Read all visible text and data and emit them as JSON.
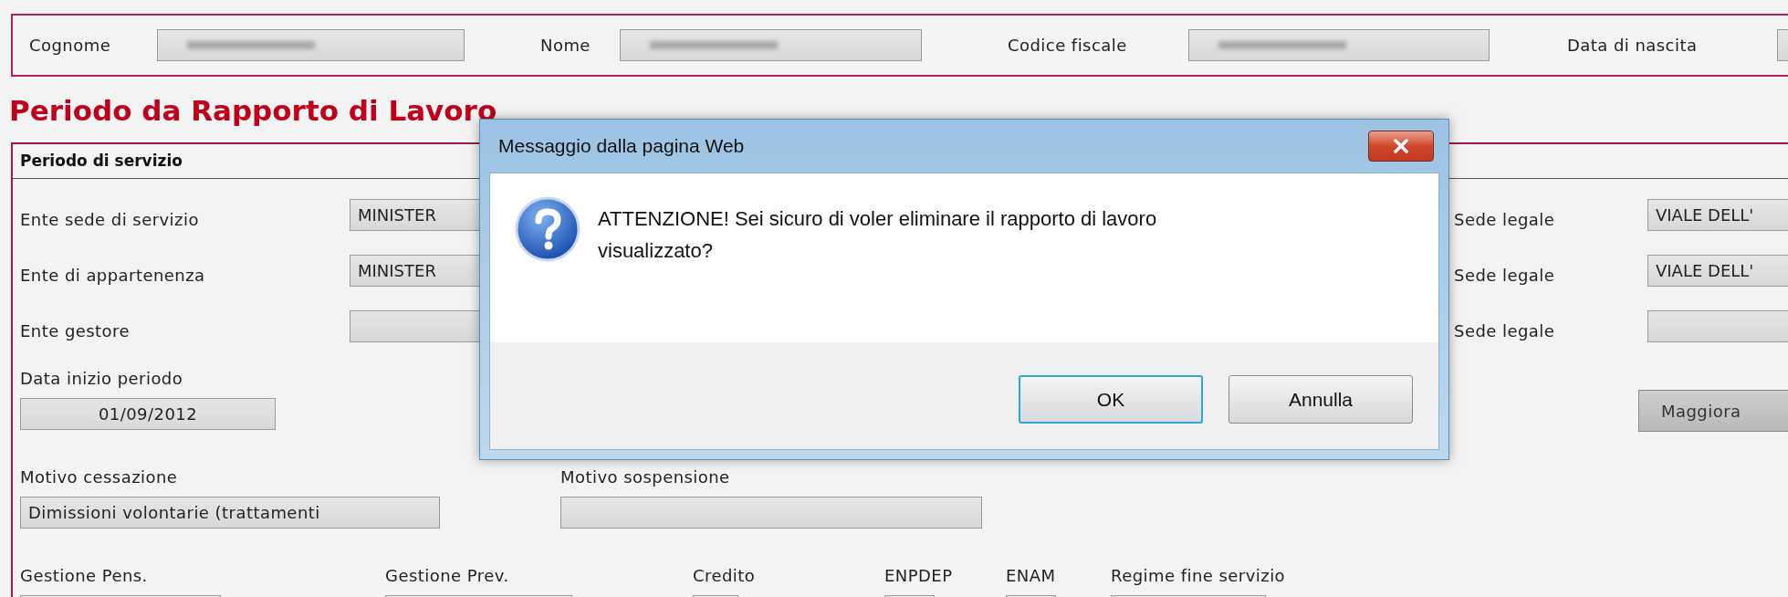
{
  "person_bar": {
    "fields": [
      {
        "label": "Cognome"
      },
      {
        "label": "Nome"
      },
      {
        "label": "Codice fiscale"
      },
      {
        "label": "Data di nascita"
      }
    ]
  },
  "heading": "Periodo da Rapporto di Lavoro",
  "panel": {
    "title": "Periodo di servizio",
    "ente_rows": [
      {
        "label": "Ente sede di servizio",
        "value": "MINISTER",
        "sede_label": "Sede legale",
        "sede_value": "VIALE DELL'"
      },
      {
        "label": "Ente di appartenenza",
        "value": "MINISTER",
        "sede_label": "Sede legale",
        "sede_value": "VIALE DELL'"
      },
      {
        "label": "Ente gestore",
        "sede_label": "Sede legale"
      }
    ],
    "data_inizio": {
      "label": "Data inizio periodo",
      "value": "01/09/2012"
    },
    "maggiora_button": "Maggiora",
    "motivo_cessazione": {
      "label": "Motivo cessazione",
      "value": "Dimissioni volontarie (trattamenti"
    },
    "motivo_sospensione": {
      "label": "Motivo sospensione"
    },
    "bottom_fields": [
      {
        "label": "Gestione Pens."
      },
      {
        "label": "Gestione Prev."
      },
      {
        "label": "Credito"
      },
      {
        "label": "ENPDEP"
      },
      {
        "label": "ENAM"
      },
      {
        "label": "Regime fine servizio"
      }
    ]
  },
  "dialog": {
    "title": "Messaggio dalla pagina Web",
    "message": "ATTENZIONE! Sei sicuro di voler eliminare il rapporto di lavoro visualizzato?",
    "buttons": [
      {
        "label": "OK",
        "selected": true
      },
      {
        "label": "Annulla",
        "selected": false
      }
    ]
  }
}
